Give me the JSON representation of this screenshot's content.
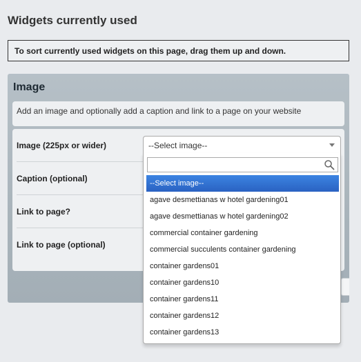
{
  "page": {
    "title": "Widgets currently used",
    "notice": "To sort currently used widgets on this page, drag them up and down."
  },
  "widget": {
    "title": "Image",
    "description": "Add an image and optionally add a caption and link to a page on your website",
    "fields": [
      {
        "label": "Image (225px or wider)"
      },
      {
        "label": "Caption (optional)"
      },
      {
        "label": "Link to page?"
      },
      {
        "label": "Link to page (optional)"
      }
    ],
    "image_select": {
      "selected": "--Select image--",
      "search_placeholder": "",
      "options": [
        "--Select image--",
        "agave desmettianas w hotel gardening01",
        "agave desmettianas w hotel gardening02",
        "commercial container gardening",
        "commercial succulents container gardening",
        "container gardens01",
        "container gardens10",
        "container gardens11",
        "container gardens12",
        "container gardens13"
      ]
    }
  },
  "colors": {
    "highlight": "#3875d7",
    "panel": "#aab5bc",
    "background": "#e9ebee"
  }
}
